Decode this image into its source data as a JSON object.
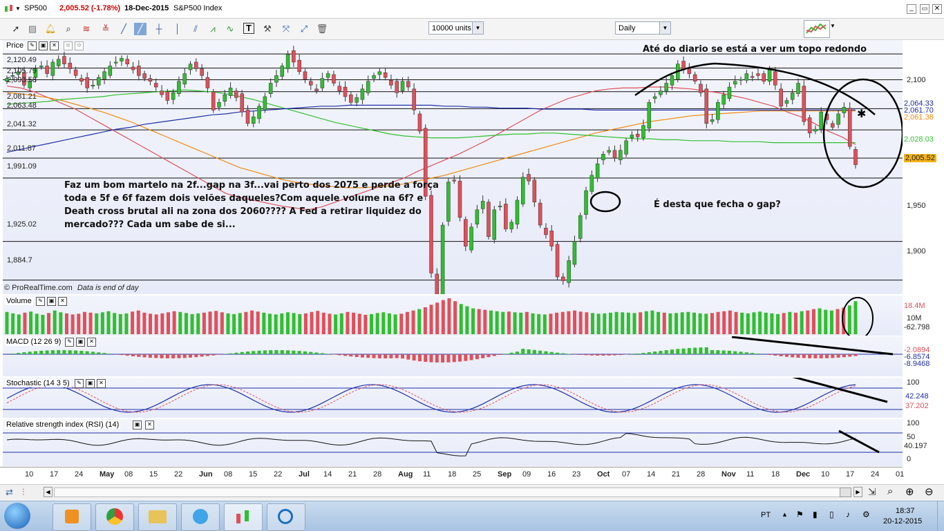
{
  "titlebar": {
    "symbol": "SP500",
    "change": "2,005.52 (-1.78%)",
    "date": "18-Dec-2015",
    "name": "S&P500 Index"
  },
  "toolbar": {
    "units": "10000 units",
    "period": "Daily"
  },
  "price_panel": {
    "label": "Price",
    "levels": [
      "2,120.49",
      "2,105.79",
      "2,093.58",
      "2,081.21",
      "2,063.48",
      "2,041.32",
      "2,011.87",
      "1,991.09",
      "1,925.02",
      "1,884.7"
    ],
    "axis_ticks": [
      "2,100",
      "1,950",
      "1,900"
    ],
    "tags": [
      {
        "text": "2,064.33",
        "color": "#1e2fa8"
      },
      {
        "text": "2,061.70",
        "color": "#1e2fa8"
      },
      {
        "text": "2,061.38",
        "color": "#f08a10"
      },
      {
        "text": "2,028.03",
        "color": "#2fbf2f"
      },
      {
        "text": "2,005.52",
        "color": "#000000"
      }
    ],
    "credit": "© ProRealTime.com",
    "note": "Data is end of day",
    "annotations": {
      "top": "Até do diario se está a ver um topo redondo",
      "left": "Faz um bom martelo na 2f...gap na 3f...vai perto dos 2075 e perde a força toda e 5f e 6f fazem dois velões daqueles?Com aquele volume na 6f? e Death cross brutal ali na zona dos 2060???? A Fed a retirar liquidez do mercado??? Cada um sabe de si...",
      "gap": "É desta que fecha o gap?"
    }
  },
  "volume_panel": {
    "label": "Volume",
    "tags": [
      "18.4M",
      "10M",
      "-62.798"
    ]
  },
  "macd_panel": {
    "label": "MACD (12 26 9)",
    "tags": [
      "-2.0894",
      "-6.8574",
      "-8.9468"
    ]
  },
  "stoch_panel": {
    "label": "Stochastic (14 3 5)",
    "tags": [
      "100",
      "42.248",
      "37.202"
    ]
  },
  "rsi_panel": {
    "label": "Relative strength index (RSI) (14)",
    "tags": [
      "100",
      "50",
      "40.197",
      "0"
    ]
  },
  "x_axis": {
    "labels": [
      "10",
      "17",
      "24",
      "May",
      "08",
      "15",
      "22",
      "Jun",
      "08",
      "15",
      "22",
      "Jul",
      "14",
      "21",
      "28",
      "Aug",
      "11",
      "18",
      "25",
      "Sep",
      "09",
      "16",
      "23",
      "Oct",
      "07",
      "14",
      "21",
      "28",
      "Nov",
      "11",
      "18",
      "Dec",
      "10",
      "17",
      "24",
      "01"
    ]
  },
  "taskbar": {
    "language": "PT",
    "time": "18:37",
    "date": "20-12-2015"
  },
  "colors": {
    "bull": "#2fbf2f",
    "bear": "#e0505a",
    "ma_blue": "#1e2fa8",
    "ma_orange": "#f08a10",
    "ma_green": "#2fbf2f",
    "ma_red": "#e0505a"
  },
  "chart_data": {
    "type": "candlestick",
    "title": "S&P500 Index",
    "interval": "Daily",
    "last_close": 2005.52,
    "change_pct": -1.78,
    "ylim": [
      1870,
      2135
    ],
    "closes": [
      2095,
      2098,
      2102,
      2088,
      2092,
      2105,
      2108,
      2100,
      2112,
      2115,
      2110,
      2105,
      2098,
      2092,
      2085,
      2088,
      2096,
      2102,
      2108,
      2112,
      2116,
      2110,
      2104,
      2098,
      2095,
      2092,
      2086,
      2078,
      2072,
      2080,
      2092,
      2100,
      2110,
      2105,
      2098,
      2085,
      2062,
      2070,
      2078,
      2085,
      2075,
      2060,
      2048,
      2055,
      2066,
      2076,
      2090,
      2098,
      2108,
      2120,
      2112,
      2102,
      2094,
      2088,
      2082,
      2095,
      2100,
      2090,
      2082,
      2076,
      2070,
      2075,
      2084,
      2092,
      2098,
      2102,
      2096,
      2088,
      2080,
      2092,
      2086,
      2062,
      2040,
      1972,
      1892,
      1867,
      1942,
      1987,
      1988,
      1950,
      1920,
      1940,
      1958,
      1967,
      1930,
      1958,
      1962,
      1938,
      1945,
      1968,
      1992,
      1988,
      1966,
      1942,
      1932,
      1920,
      1888,
      1884,
      1905,
      1925,
      1952,
      1978,
      1994,
      2006,
      2016,
      2020,
      2012,
      2020,
      2030,
      2036,
      2034,
      2046,
      2070,
      2076,
      2082,
      2090,
      2098,
      2110,
      2104,
      2100,
      2092,
      2080,
      2048,
      2052,
      2070,
      2078,
      2086,
      2092,
      2094,
      2100,
      2096,
      2098,
      2092,
      2104,
      2088,
      2066,
      2072,
      2080,
      2090,
      2050,
      2038,
      2042,
      2060,
      2052,
      2044,
      2058,
      2065,
      2024,
      2005
    ],
    "series": [
      {
        "name": "MA20",
        "color": "#e0505a",
        "values": [
          2087,
          2085,
          2081,
          2075,
          2069,
          2063,
          2055,
          2047,
          2039,
          2031,
          2023,
          2015,
          2007,
          1999,
          1991,
          1983,
          1975,
          1971,
          1968,
          1965,
          1962,
          1960,
          1958,
          1961,
          1966,
          1971,
          1976,
          1981,
          1986,
          1991,
          1998,
          2004,
          2010,
          2016,
          2023,
          2030,
          2038,
          2046,
          2054,
          2062,
          2068,
          2074,
          2078,
          2082,
          2084,
          2085,
          2085,
          2086,
          2086,
          2085,
          2084,
          2082,
          2080,
          2077,
          2074,
          2070,
          2066,
          2060,
          2055,
          2048,
          2040,
          2034,
          2026
        ]
      },
      {
        "name": "MA50",
        "color": "#f08a10",
        "values": [
          2080,
          2079,
          2077,
          2075,
          2072,
          2068,
          2064,
          2060,
          2055,
          2050,
          2044,
          2038,
          2032,
          2026,
          2020,
          2014,
          2008,
          2002,
          1998,
          1994,
          1990,
          1987,
          1985,
          1983,
          1982,
          1981,
          1981,
          1982,
          1983,
          1985,
          1988,
          1991,
          1994,
          1998,
          2002,
          2006,
          2010,
          2014,
          2018,
          2022,
          2026,
          2030,
          2034,
          2038,
          2041,
          2044,
          2047,
          2050,
          2052,
          2054,
          2056,
          2057,
          2058,
          2059,
          2060,
          2061,
          2061,
          2061,
          2061,
          2061,
          2061,
          2061,
          2061
        ]
      },
      {
        "name": "MA100",
        "color": "#2fbf2f",
        "values": [
          2068,
          2069,
          2070,
          2071,
          2073,
          2074,
          2075,
          2076,
          2078,
          2079,
          2080,
          2081,
          2082,
          2083,
          2082,
          2081,
          2079,
          2076,
          2073,
          2069,
          2065,
          2061,
          2057,
          2053,
          2049,
          2046,
          2043,
          2040,
          2037,
          2035,
          2034,
          2033,
          2033,
          2033,
          2034,
          2035,
          2036,
          2037,
          2037,
          2038,
          2038,
          2037,
          2036,
          2035,
          2034,
          2033,
          2032,
          2032,
          2031,
          2031,
          2030,
          2030,
          2030,
          2029,
          2029,
          2029,
          2028,
          2028,
          2028,
          2028,
          2028,
          2028,
          2028
        ]
      },
      {
        "name": "MA200",
        "color": "#1e2fa8",
        "values": [
          2018,
          2021,
          2024,
          2027,
          2030,
          2033,
          2036,
          2039,
          2042,
          2044,
          2047,
          2049,
          2051,
          2053,
          2055,
          2057,
          2058,
          2060,
          2061,
          2062,
          2063,
          2064,
          2065,
          2066,
          2066,
          2067,
          2067,
          2067,
          2067,
          2067,
          2067,
          2067,
          2066,
          2066,
          2065,
          2065,
          2064,
          2064,
          2064,
          2063,
          2063,
          2063,
          2063,
          2062,
          2062,
          2062,
          2062,
          2062,
          2062,
          2062,
          2062,
          2062,
          2062,
          2062,
          2062,
          2062,
          2062,
          2062,
          2062,
          2062,
          2062,
          2062,
          2062
        ]
      }
    ],
    "volume": [
      62,
      58,
      55,
      60,
      63,
      57,
      54,
      59,
      66,
      61,
      58,
      55,
      57,
      62,
      60,
      58,
      61,
      64,
      59,
      56,
      58,
      63,
      66,
      60,
      57,
      55,
      58,
      61,
      64,
      62,
      59,
      56,
      58,
      60,
      63,
      65,
      61,
      58,
      56,
      59,
      62,
      66,
      63,
      60,
      57,
      55,
      58,
      61,
      59,
      56,
      58,
      62,
      65,
      60,
      57,
      55,
      58,
      62,
      60,
      57,
      54,
      56,
      59,
      61,
      58,
      55,
      57,
      62,
      66,
      70,
      75,
      82,
      88,
      95,
      100,
      92,
      84,
      78,
      72,
      70,
      68,
      66,
      64,
      62,
      63,
      61,
      60,
      62,
      58,
      56,
      55,
      57,
      60,
      62,
      64,
      66,
      63,
      61,
      59,
      57,
      58,
      60,
      62,
      61,
      60,
      59,
      61,
      64,
      66,
      62,
      60,
      58,
      59,
      61,
      62,
      60,
      58,
      57,
      59,
      62,
      64,
      66,
      62,
      60,
      58,
      61,
      63,
      60,
      58,
      56,
      59,
      62,
      60,
      64,
      66,
      70,
      72,
      68,
      66,
      70,
      74,
      80,
      92
    ],
    "rsi_last": 40.197,
    "stochastic_last": [
      42.248,
      37.202
    ],
    "macd_last": [
      -2.0894,
      -6.8574,
      -8.9468
    ]
  }
}
